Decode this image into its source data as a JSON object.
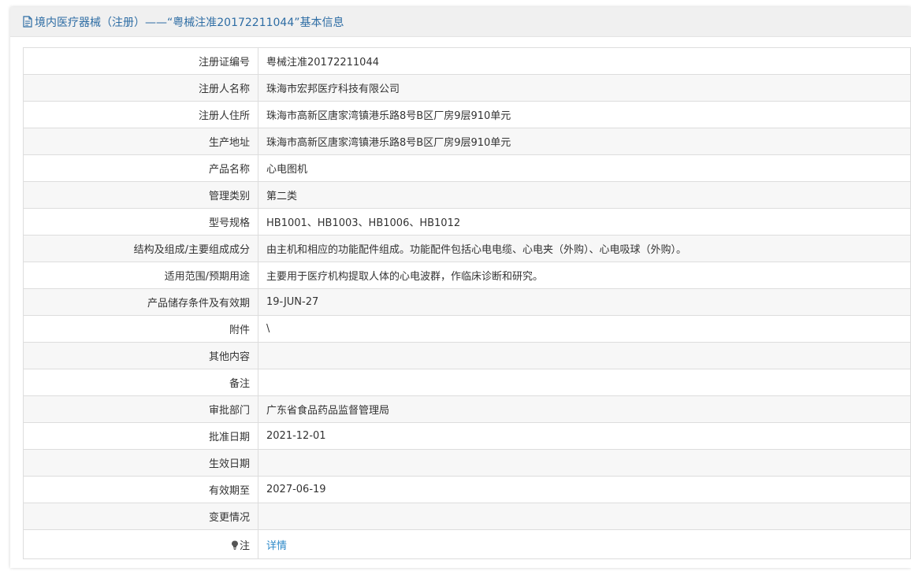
{
  "header": {
    "title": "境内医疗器械（注册）——“粤械注准20172211044”基本信息"
  },
  "rows": [
    {
      "label": "注册证编号",
      "value": "粤械注准20172211044"
    },
    {
      "label": "注册人名称",
      "value": "珠海市宏邦医疗科技有限公司"
    },
    {
      "label": "注册人住所",
      "value": "珠海市高新区唐家湾镇港乐路8号B区厂房9层910单元"
    },
    {
      "label": "生产地址",
      "value": "珠海市高新区唐家湾镇港乐路8号B区厂房9层910单元"
    },
    {
      "label": "产品名称",
      "value": "心电图机"
    },
    {
      "label": "管理类别",
      "value": "第二类"
    },
    {
      "label": "型号规格",
      "value": "HB1001、HB1003、HB1006、HB1012"
    },
    {
      "label": "结构及组成/主要组成成分",
      "value": "由主机和相应的功能配件组成。功能配件包括心电电缆、心电夹（外购）、心电吸球（外购）。"
    },
    {
      "label": "适用范围/预期用途",
      "value": "主要用于医疗机构提取人体的心电波群，作临床诊断和研究。"
    },
    {
      "label": "产品储存条件及有效期",
      "value": "19-JUN-27"
    },
    {
      "label": "附件",
      "value": "\\"
    },
    {
      "label": "其他内容",
      "value": ""
    },
    {
      "label": "备注",
      "value": ""
    },
    {
      "label": "审批部门",
      "value": "广东省食品药品监督管理局"
    },
    {
      "label": "批准日期",
      "value": "2021-12-01"
    },
    {
      "label": "生效日期",
      "value": ""
    },
    {
      "label": "有效期至",
      "value": "2027-06-19"
    },
    {
      "label": "变更情况",
      "value": ""
    }
  ],
  "note_row": {
    "icon": "lightbulb-icon",
    "label": "注",
    "link_text": "详情"
  },
  "colors": {
    "header_text": "#2e6da4",
    "link": "#2e8ac9",
    "border": "#dddddd",
    "stripe": "#f7f7f7"
  }
}
